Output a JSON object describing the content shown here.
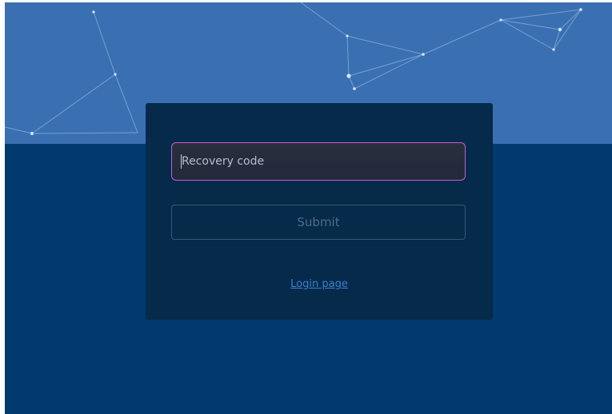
{
  "recovery_form": {
    "code_input": {
      "placeholder": "Recovery code",
      "value": ""
    },
    "submit_label": "Submit",
    "login_link_label": "Login page"
  },
  "colors": {
    "background": "#003a6e",
    "hero_background": "#3a70b2",
    "card_background": "#052a4a",
    "input_focus_border": "#c45bd6",
    "link": "#3f7fce"
  }
}
